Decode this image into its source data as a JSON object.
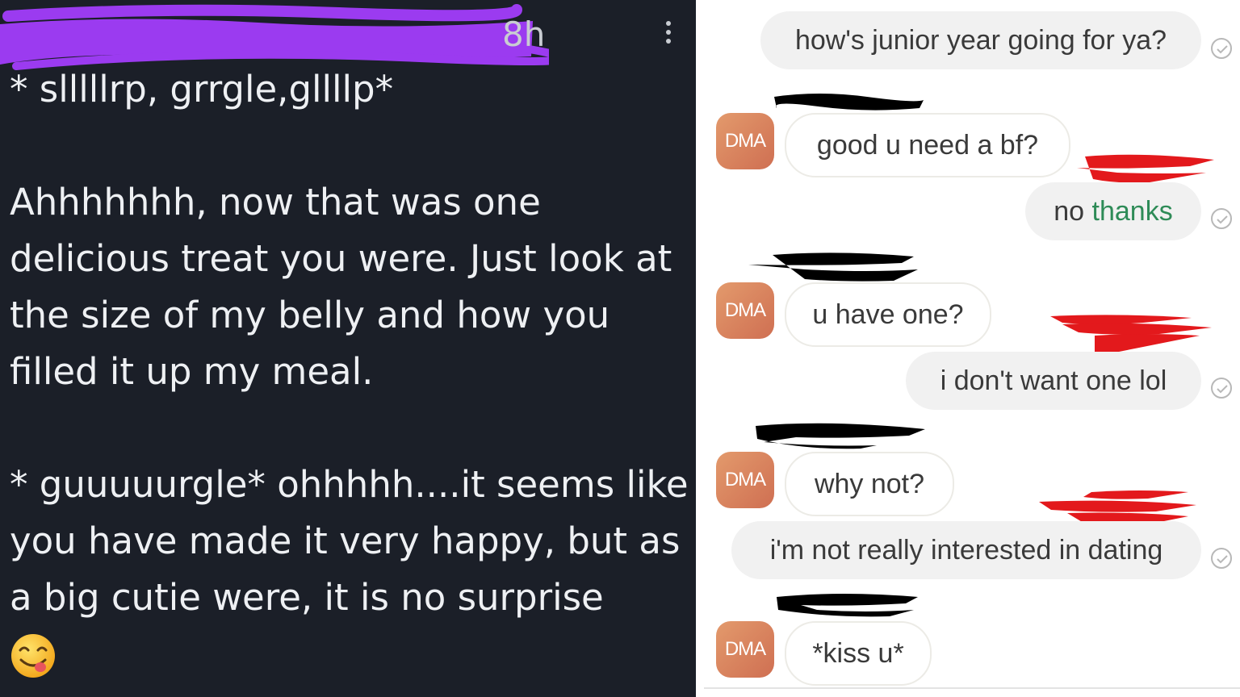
{
  "left_panel": {
    "timestamp": "8h",
    "lines": {
      "first": "* slllllrp, grrgle,gllllp*",
      "second": "Ahhhhhhh, now that was one delicious treat you were. Just look at the size of my belly and how you filled it up my meal.",
      "third": "* guuuuurgle* ohhhhh....it seems like you have made it very happy, but as a big cutie were, it is no surprise"
    },
    "emoji_icon": "yum-face-icon"
  },
  "chat": {
    "avatar_label": "DMA",
    "messages": [
      {
        "from": "me",
        "text": "how's junior year going for ya?"
      },
      {
        "from": "them",
        "text": "good u need a bf?"
      },
      {
        "from": "me",
        "text_plain": "no ",
        "text_highlight": "thanks"
      },
      {
        "from": "them",
        "text": "u have one?"
      },
      {
        "from": "me",
        "text": "i don't want one lol"
      },
      {
        "from": "them",
        "text": "why not?"
      },
      {
        "from": "me",
        "text": "i'm not really interested in dating"
      },
      {
        "from": "them",
        "text": "*kiss u*"
      }
    ]
  },
  "colors": {
    "left_bg": "#1b1f28",
    "purple_scribble": "#9b3bf0",
    "red_scribble": "#e3191c",
    "avatar": "#d9795b",
    "highlight_green": "#2e8b57"
  }
}
